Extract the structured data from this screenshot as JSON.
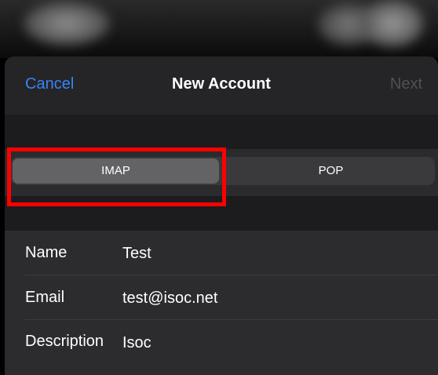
{
  "navbar": {
    "cancel_label": "Cancel",
    "title": "New Account",
    "next_label": "Next"
  },
  "segmented_control": {
    "options": [
      "IMAP",
      "POP"
    ],
    "selected": "IMAP"
  },
  "form": {
    "rows": [
      {
        "label": "Name",
        "value": "Test"
      },
      {
        "label": "Email",
        "value": "test@isoc.net"
      },
      {
        "label": "Description",
        "value": "Isoc"
      }
    ]
  },
  "colors": {
    "accent": "#3a82f7",
    "highlight_box": "#ff0000",
    "background": "#1c1c1e"
  }
}
